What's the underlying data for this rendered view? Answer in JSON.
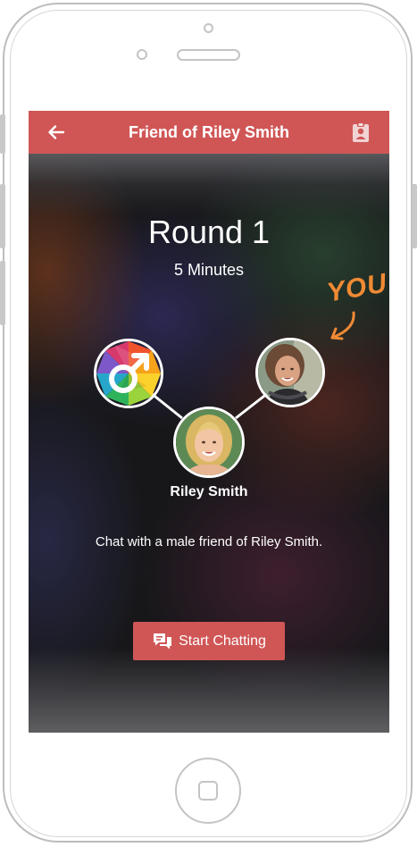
{
  "app_bar": {
    "title": "Friend of Riley Smith",
    "back_icon": "arrow-back-icon",
    "right_icon": "clipboard-account-icon"
  },
  "round": {
    "title": "Round 1",
    "duration": "5 Minutes"
  },
  "you_label": "YOU",
  "people": {
    "center_name": "Riley Smith"
  },
  "description": "Chat with a male friend of Riley Smith.",
  "start_button": {
    "label": "Start Chatting",
    "icon": "chat-bubbles-icon"
  },
  "colors": {
    "accent": "#d05656",
    "you_label": "#f08a34",
    "background": "#17171a"
  }
}
